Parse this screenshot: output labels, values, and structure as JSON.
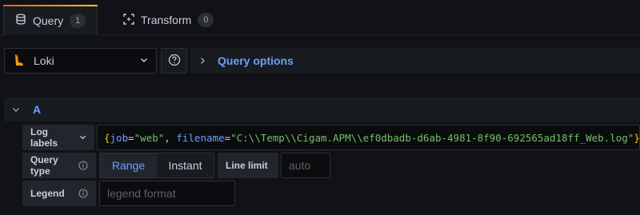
{
  "tabs": [
    {
      "label": "Query",
      "count": "1",
      "icon": "database-icon",
      "active": true
    },
    {
      "label": "Transform",
      "count": "0",
      "icon": "transform-icon",
      "active": false
    }
  ],
  "datasource": {
    "name": "Loki",
    "icon": "loki-logo-icon"
  },
  "help_icon": "question-circle-icon",
  "query_options": {
    "label": "Query options"
  },
  "query_row": {
    "ref_id": "A",
    "log_labels": {
      "label": "Log labels",
      "query": "{job=\"web\", filename=\"C:\\\\Temp\\\\Cigam.APM\\\\ef0dbadb-d6ab-4981-8f90-692565ad18ff_Web.log\"}",
      "tokens": {
        "open": "{",
        "key1": "job",
        "eq1": "=",
        "val1": "\"web\"",
        "sep": ", ",
        "key2": "filename",
        "eq2": "=",
        "val2": "\"C:\\\\Temp\\\\Cigam.APM\\\\ef0dbadb-d6ab-4981-8f90-692565ad18ff_Web.log\"",
        "close": "}"
      }
    },
    "query_type": {
      "label": "Query type",
      "options": [
        "Range",
        "Instant"
      ],
      "selected": "Range"
    },
    "line_limit": {
      "label": "Line limit",
      "placeholder": "auto",
      "value": ""
    },
    "legend": {
      "label": "Legend",
      "placeholder": "legend format",
      "value": ""
    }
  },
  "colors": {
    "accent_blue": "#6e9fff",
    "brace_yellow": "#f2cc0c",
    "string_green": "#73bf69",
    "tab_gradient_start": "#f05a28",
    "tab_gradient_end": "#fbca0a"
  }
}
